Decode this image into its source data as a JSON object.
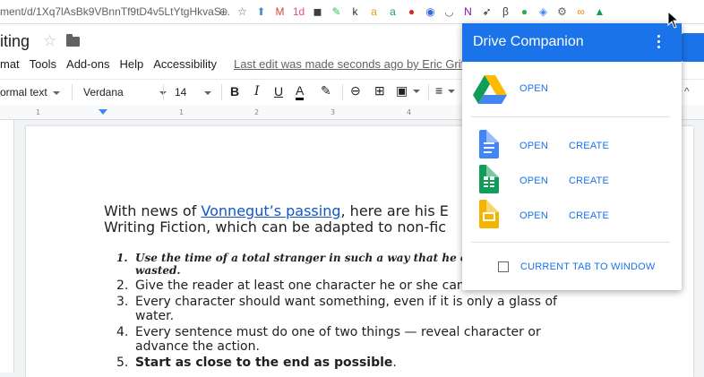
{
  "browser": {
    "url": "ment/d/1Xq7lAsBk9VBnnTf9tD4v5LtYtgHkvaS...",
    "extensions": [
      {
        "name": "zoom-icon",
        "glyph": "⊕",
        "color": "#5f6368"
      },
      {
        "name": "bookmark-star-icon",
        "glyph": "☆",
        "color": "#5f6368"
      },
      {
        "name": "home-icon",
        "glyph": "⬆",
        "color": "#4a90d9"
      },
      {
        "name": "gmail-icon",
        "glyph": "M",
        "color": "#db4437"
      },
      {
        "name": "calendar-icon",
        "glyph": "1d",
        "color": "#e94a8a"
      },
      {
        "name": "camera-icon",
        "glyph": "◼",
        "color": "#3c4043"
      },
      {
        "name": "evernote-icon",
        "glyph": "✎",
        "color": "#2dbe60"
      },
      {
        "name": "k-icon",
        "glyph": "k",
        "color": "#2b2b2b"
      },
      {
        "name": "amazon-icon",
        "glyph": "a",
        "color": "#f0a000"
      },
      {
        "name": "a-icon",
        "glyph": "a",
        "color": "#1aa260"
      },
      {
        "name": "lastpass-icon",
        "glyph": "●",
        "color": "#d32d27"
      },
      {
        "name": "link-icon",
        "glyph": "◉",
        "color": "#3367d6"
      },
      {
        "name": "pocket-icon",
        "glyph": "◡",
        "color": "#5f6368"
      },
      {
        "name": "onenote-icon",
        "glyph": "N",
        "color": "#7719aa"
      },
      {
        "name": "rocket-icon",
        "glyph": "➶",
        "color": "#202124"
      },
      {
        "name": "beta-icon",
        "glyph": "β",
        "color": "#3c4043"
      },
      {
        "name": "green-drop-icon",
        "glyph": "●",
        "color": "#34a853"
      },
      {
        "name": "shield-icon",
        "glyph": "◈",
        "color": "#4285f4"
      },
      {
        "name": "settings-icon",
        "glyph": "⚙",
        "color": "#5f6368"
      },
      {
        "name": "infinity-icon",
        "glyph": "∞",
        "color": "#f57c00"
      },
      {
        "name": "drive-companion-icon",
        "glyph": "▲",
        "color": "#0f9d58"
      }
    ]
  },
  "docs": {
    "title": "iting",
    "menu": [
      "mat",
      "Tools",
      "Add-ons",
      "Help",
      "Accessibility"
    ],
    "last_edit": "Last edit was made seconds ago by Eric Griff",
    "toolbar": {
      "style": "ormal text",
      "font": "Verdana",
      "size": "14"
    }
  },
  "document": {
    "line1_pre": "With news of ",
    "line1_link": "Vonnegut’s passing",
    "line1_post": ", here are his E",
    "line2": "Writing Fiction, which can be adapted to non-fic",
    "items": [
      {
        "n": "1.",
        "text": "Use the time of a total stranger in such a way that he or she w",
        "text2": "wasted.",
        "style": "script"
      },
      {
        "n": "2.",
        "text": "Give the reader at least one character he or she can root for.",
        "style": ""
      },
      {
        "n": "3.",
        "text": "Every character should want something, even if it is only a glass of water.",
        "style": ""
      },
      {
        "n": "4.",
        "text": "Every sentence must do one of two things — reveal character or advance the action.",
        "style": ""
      },
      {
        "n": "5.",
        "text": "Start as close to the end as possible",
        "suffix": ".",
        "style": "bold"
      }
    ]
  },
  "popup": {
    "title": "Drive Companion",
    "drive_open": "OPEN",
    "apps": [
      {
        "name": "docs",
        "color": "#4285f4",
        "open": "OPEN",
        "create": "CREATE"
      },
      {
        "name": "sheets",
        "color": "#0f9d58",
        "open": "OPEN",
        "create": "CREATE"
      },
      {
        "name": "slides",
        "color": "#f4b400",
        "open": "OPEN",
        "create": "CREATE"
      }
    ],
    "current_tab": "CURRENT TAB TO WINDOW"
  }
}
